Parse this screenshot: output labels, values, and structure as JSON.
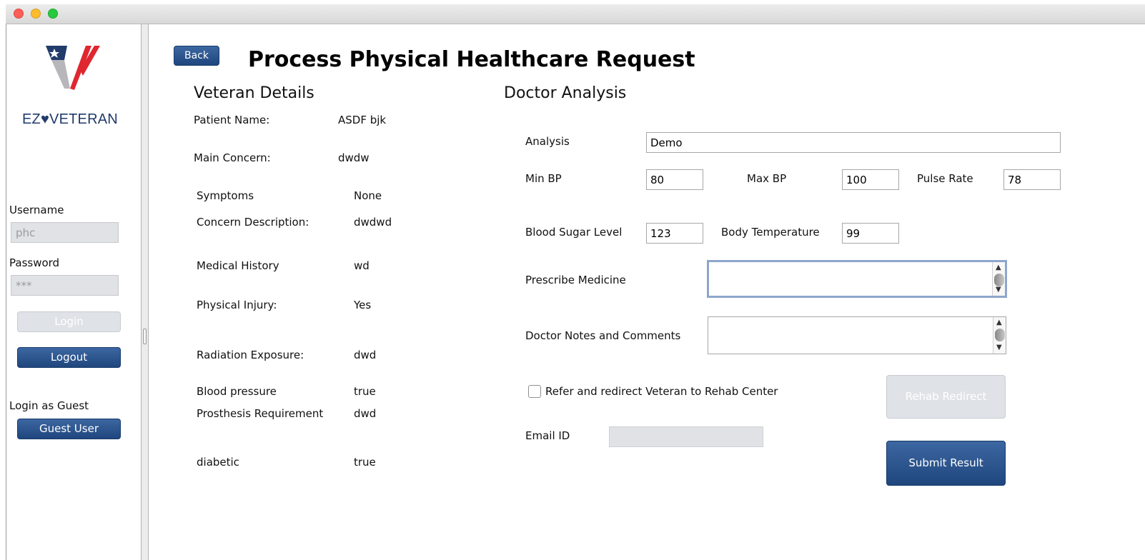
{
  "sidebar": {
    "brand": "EZ♥VETERAN",
    "username_label": "Username",
    "username_value": "phc",
    "password_label": "Password",
    "password_value": "***",
    "login_label": "Login",
    "logout_label": "Logout",
    "guest_heading": "Login as Guest",
    "guest_button": "Guest User"
  },
  "header": {
    "back_label": "Back",
    "title": "Process Physical Healthcare Request"
  },
  "veteran": {
    "heading": "Veteran Details",
    "rows": [
      {
        "label": "Patient Name:",
        "value": "ASDF bjk"
      },
      {
        "label": "Main Concern:",
        "value": "dwdw"
      },
      {
        "label": "Symptoms",
        "value": "None"
      },
      {
        "label": "Concern Description:",
        "value": "dwdwd"
      },
      {
        "label": "Medical History",
        "value": "wd"
      },
      {
        "label": "Physical Injury:",
        "value": "Yes"
      },
      {
        "label": "Radiation Exposure:",
        "value": "dwd"
      },
      {
        "label": "Blood pressure",
        "value": "true"
      },
      {
        "label": "Prosthesis Requirement",
        "value": "dwd"
      },
      {
        "label": "diabetic",
        "value": "true"
      }
    ]
  },
  "doctor": {
    "heading": "Doctor Analysis",
    "analysis_label": "Analysis",
    "analysis_value": "Demo",
    "min_bp_label": "Min BP",
    "min_bp_value": "80",
    "max_bp_label": "Max BP",
    "max_bp_value": "100",
    "pulse_label": "Pulse Rate",
    "pulse_value": "78",
    "sugar_label": "Blood Sugar Level",
    "sugar_value": "123",
    "temp_label": "Body Temperature",
    "temp_value": "99",
    "medicine_label": "Prescribe Medicine",
    "notes_label": "Doctor Notes and Comments",
    "refer_label": "Refer and redirect Veteran to Rehab Center",
    "email_label": "Email ID",
    "rehab_button": "Rehab Redirect",
    "submit_button": "Submit Result"
  },
  "colors": {
    "accent": "#2a5188",
    "disabled": "#dfe2e7",
    "logo_navy": "#213b6b",
    "logo_red": "#e0262f"
  }
}
